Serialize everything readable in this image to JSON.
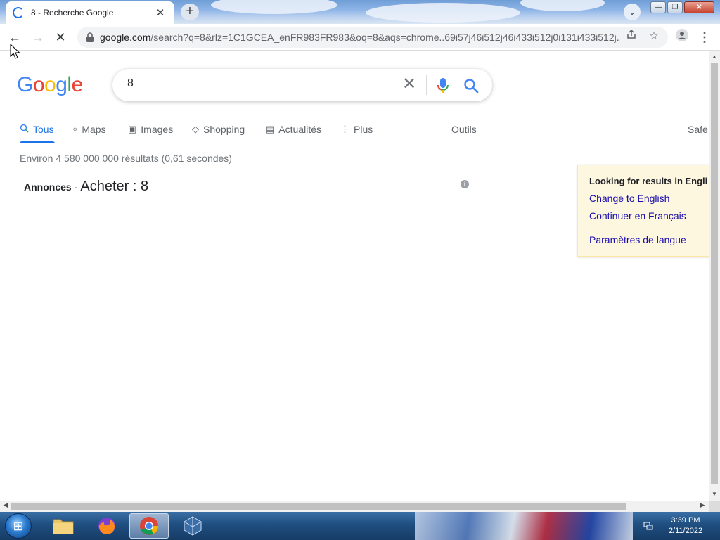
{
  "browser": {
    "tab_title": "8 - Recherche Google",
    "tab_close": "✕",
    "new_tab": "+",
    "tabs_dropdown": "⌄",
    "window_buttons": {
      "minimize": "—",
      "maximize": "❐",
      "close": "✕"
    },
    "url_host": "google.com",
    "url_rest": "/search?q=8&rlz=1C1GCEA_enFR983FR983&oq=8&aqs=chrome..69i57j46i512j46i433i512j0i131i433i512j...",
    "nav": {
      "back": "←",
      "forward": "→",
      "stop": "✕"
    }
  },
  "google": {
    "logo_letters": [
      "G",
      "o",
      "o",
      "g",
      "l",
      "e"
    ],
    "search": {
      "query": "8",
      "clear": "✕"
    },
    "tabs": [
      {
        "label": "Tous",
        "icon": "search-icon",
        "glyph": "🔍"
      },
      {
        "label": "Maps",
        "icon": "map-pin-icon",
        "glyph": "⌖"
      },
      {
        "label": "Images",
        "icon": "image-icon",
        "glyph": "▣"
      },
      {
        "label": "Shopping",
        "icon": "tag-icon",
        "glyph": "◇"
      },
      {
        "label": "Actualités",
        "icon": "news-icon",
        "glyph": "▤"
      },
      {
        "label": "Plus",
        "icon": "more-vert-icon",
        "glyph": "⋮"
      }
    ],
    "tools": "Outils",
    "safesearch": "Safe",
    "result_stats": "Environ 4 580 000 000 résultats (0,61 secondes)",
    "ads": {
      "label": "Annonces",
      "dot": "·",
      "title": "Acheter : 8",
      "info": "i"
    },
    "language_box": {
      "heading": "Looking for results in Engli",
      "links": [
        "Change to English",
        "Continuer en Français",
        "Paramètres de langue"
      ]
    }
  },
  "taskbar": {
    "start": "⊞",
    "clock_time": "3:39 PM",
    "clock_date": "2/11/2022",
    "items": [
      {
        "name": "file-explorer",
        "glyph": "🗀"
      },
      {
        "name": "firefox",
        "glyph": "🦊"
      },
      {
        "name": "chrome",
        "glyph": "◉"
      },
      {
        "name": "virtualbox",
        "glyph": "⬡"
      }
    ]
  },
  "colors": {
    "google_blue": "#1a73e8",
    "link": "#1a0dab",
    "lang_box_bg": "#fef7e0"
  }
}
